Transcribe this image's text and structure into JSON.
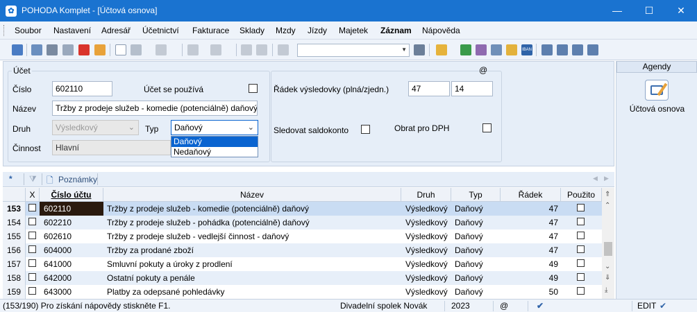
{
  "window": {
    "title": "POHODA Komplet - [Účtová osnova]",
    "minimize": "—",
    "maximize": "☐",
    "close": "✕"
  },
  "menu": [
    "Soubor",
    "Nastavení",
    "Adresář",
    "Účetnictví",
    "Fakturace",
    "Sklady",
    "Mzdy",
    "Jízdy",
    "Majetek",
    "Záznam",
    "Nápověda"
  ],
  "form": {
    "section_title": "Účet",
    "at_sign": "@",
    "cislo_label": "Číslo",
    "cislo_value": "602110",
    "ucet_pouziva_label": "Účet se používá",
    "nazev_label": "Název",
    "nazev_value": "Tržby z prodeje služeb - komedie (potenciálně) daňový",
    "druh_label": "Druh",
    "druh_value": "Výsledkový",
    "typ_label": "Typ",
    "typ_value": "Daňový",
    "typ_options": [
      "Daňový",
      "Nedaňový"
    ],
    "cinnost_label": "Činnost",
    "cinnost_value": "Hlavní",
    "radek_label": "Řádek výsledovky (plná/zjedn.)",
    "radek_plna": "47",
    "radek_zjedn": "14",
    "saldokonto_label": "Sledovat saldokonto",
    "obrat_dph_label": "Obrat pro DPH"
  },
  "agenda": {
    "header": "Agendy",
    "item_label": "Účtová osnova"
  },
  "tabs": {
    "star": "*",
    "notes": "Poznámky"
  },
  "grid": {
    "columns": [
      "X",
      "Číslo účtu",
      "Název",
      "Druh",
      "Typ",
      "Řádek",
      "Použito"
    ],
    "rows": [
      {
        "n": "153",
        "ucet": "602110",
        "nazev": "Tržby z prodeje služeb - komedie (potenciálně) daňový",
        "druh": "Výsledkový",
        "typ": "Daňový",
        "radek": "47"
      },
      {
        "n": "154",
        "ucet": "602210",
        "nazev": "Tržby z prodeje služeb - pohádka (potenciálně) daňový",
        "druh": "Výsledkový",
        "typ": "Daňový",
        "radek": "47"
      },
      {
        "n": "155",
        "ucet": "602610",
        "nazev": "Tržby z prodeje služeb - vedlejší činnost - daňový",
        "druh": "Výsledkový",
        "typ": "Daňový",
        "radek": "47"
      },
      {
        "n": "156",
        "ucet": "604000",
        "nazev": "Tržby za prodané zboží",
        "druh": "Výsledkový",
        "typ": "Daňový",
        "radek": "47"
      },
      {
        "n": "157",
        "ucet": "641000",
        "nazev": "Smluvní pokuty a úroky z prodlení",
        "druh": "Výsledkový",
        "typ": "Daňový",
        "radek": "49"
      },
      {
        "n": "158",
        "ucet": "642000",
        "nazev": "Ostatní pokuty a penále",
        "druh": "Výsledkový",
        "typ": "Daňový",
        "radek": "49"
      },
      {
        "n": "159",
        "ucet": "643000",
        "nazev": "Platby za odepsané pohledávky",
        "druh": "Výsledkový",
        "typ": "Daňový",
        "radek": "50"
      }
    ]
  },
  "status": {
    "help": "(153/190) Pro získání nápovědy stiskněte F1.",
    "company": "Divadelní spolek Novák",
    "year": "2023",
    "at": "@",
    "mode": "EDIT"
  },
  "colors": {
    "titlebar": "#1a73d0",
    "selected_row": "#c9dcf3",
    "alt_row": "#e7eff9",
    "selection_blue": "#0a64d0"
  }
}
